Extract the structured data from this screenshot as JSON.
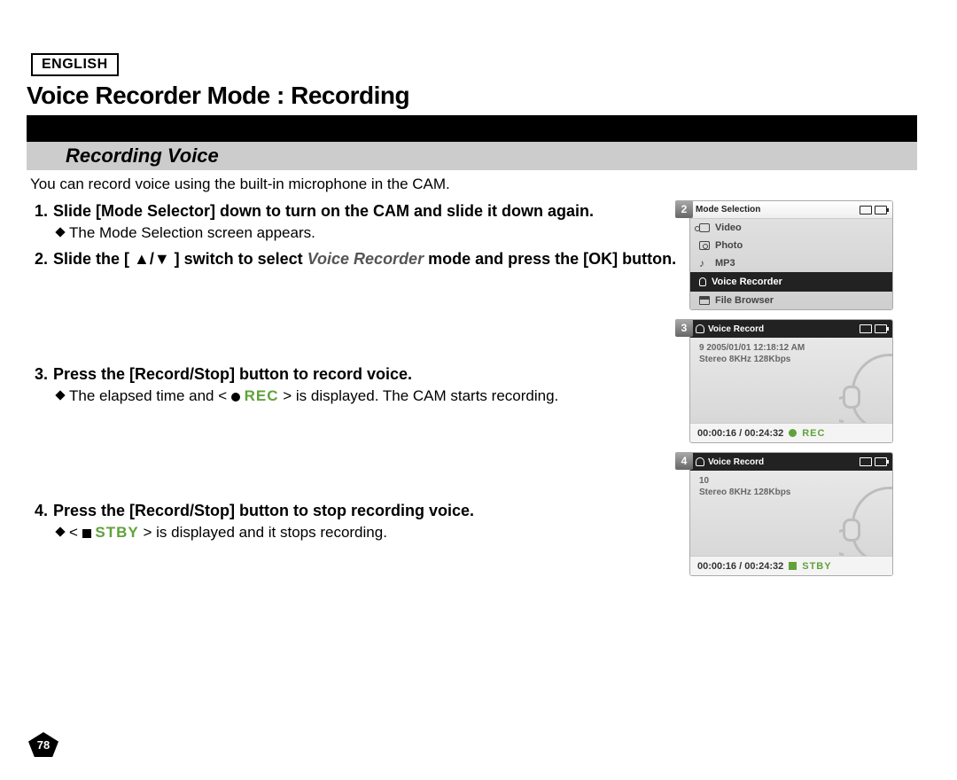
{
  "lang_label": "ENGLISH",
  "title": "Voice Recorder Mode : Recording",
  "subtitle": "Recording Voice",
  "intro": "You can record voice using the built-in microphone in the CAM.",
  "steps": {
    "s1": {
      "num": "1.",
      "main": "Slide [Mode Selector] down to turn on the CAM and slide it down again.",
      "sub": "The Mode Selection screen appears."
    },
    "s2": {
      "num": "2.",
      "main_pre": "Slide the [ ▲/▼ ] switch to select ",
      "main_var": "Voice Recorder",
      "main_post": " mode and press the [OK] button."
    },
    "s3": {
      "num": "3.",
      "main": "Press the [Record/Stop] button to record voice.",
      "sub_pre": "The elapsed time and < ",
      "sub_tag": "REC",
      "sub_post": " > is displayed. The CAM starts recording."
    },
    "s4": {
      "num": "4.",
      "main": "Press the [Record/Stop] button to stop recording voice.",
      "sub_pre": "< ",
      "sub_tag": "STBY",
      "sub_post": " > is displayed and it stops recording."
    }
  },
  "screens": {
    "s2": {
      "badge": "2",
      "header": "Mode Selection",
      "items": {
        "video": "Video",
        "photo": "Photo",
        "mp3": "MP3",
        "vr": "Voice Recorder",
        "fb": "File Browser"
      }
    },
    "s3": {
      "badge": "3",
      "header": "Voice Record",
      "line1": "9  2005/01/01 12:18:12 AM",
      "line2": "Stereo  8KHz  128Kbps",
      "time": "00:00:16 / 00:24:32",
      "tag": "REC"
    },
    "s4": {
      "badge": "4",
      "header": "Voice Record",
      "line1": "10",
      "line2": "Stereo  8KHz  128Kbps",
      "time": "00:00:16 / 00:24:32",
      "tag": "STBY"
    }
  },
  "page_number": "78"
}
